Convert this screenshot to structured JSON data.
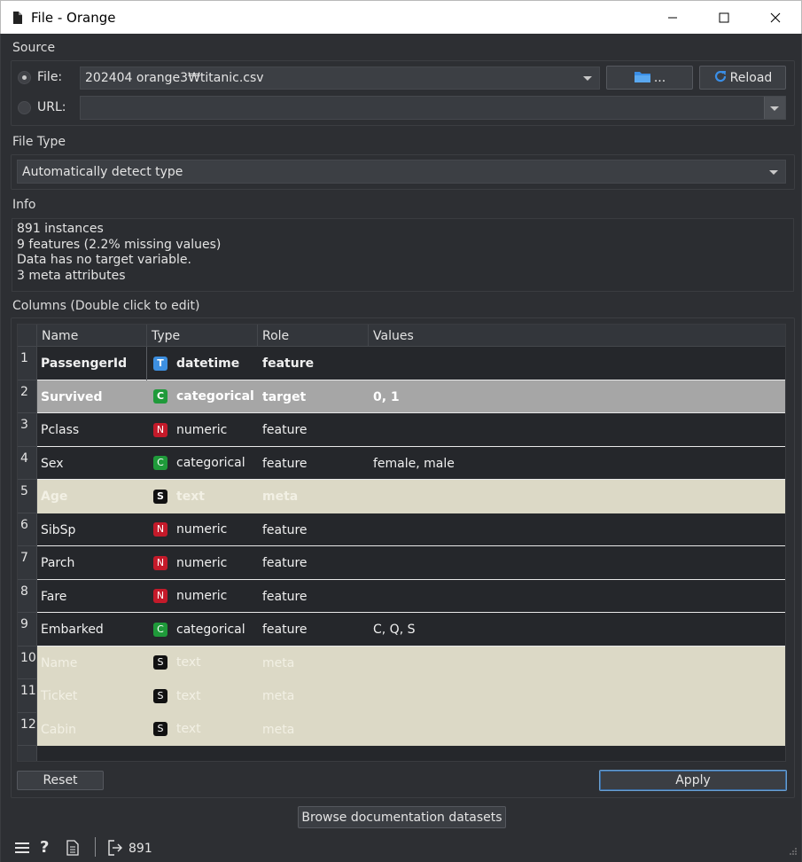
{
  "window": {
    "title": "File - Orange"
  },
  "source": {
    "label": "Source",
    "file_label": "File:",
    "file_value": "202404 orange3₩titanic.csv",
    "browse_label": "...",
    "reload_label": "Reload",
    "url_label": "URL:",
    "url_value": ""
  },
  "file_type": {
    "label": "File Type",
    "value": "Automatically detect type"
  },
  "info": {
    "label": "Info",
    "lines": [
      "891 instances",
      "9 features (2.2% missing values)",
      "Data has no target variable.",
      "3 meta attributes"
    ]
  },
  "columns": {
    "label": "Columns (Double click to edit)",
    "headers": [
      "Name",
      "Type",
      "Role",
      "Values"
    ],
    "rows": [
      {
        "num": "1",
        "name": "PassengerId",
        "type_letter": "T",
        "type": "datetime",
        "role": "feature",
        "values": "",
        "style": "normal-bold",
        "badge_color": "#3d8fe0"
      },
      {
        "num": "2",
        "name": "Survived",
        "type_letter": "C",
        "type": "categorical",
        "role": "target",
        "values": "0, 1",
        "style": "target",
        "badge_color": "#1f9a3a"
      },
      {
        "num": "3",
        "name": "Pclass",
        "type_letter": "N",
        "type": "numeric",
        "role": "feature",
        "values": "",
        "style": "normal",
        "badge_color": "#c41a2a"
      },
      {
        "num": "4",
        "name": "Sex",
        "type_letter": "C",
        "type": "categorical",
        "role": "feature",
        "values": "female, male",
        "style": "normal",
        "badge_color": "#1f9a3a"
      },
      {
        "num": "5",
        "name": "Age",
        "type_letter": "S",
        "type": "text",
        "role": "meta",
        "values": "",
        "style": "meta-bold",
        "badge_color": "#111111"
      },
      {
        "num": "6",
        "name": "SibSp",
        "type_letter": "N",
        "type": "numeric",
        "role": "feature",
        "values": "",
        "style": "normal",
        "badge_color": "#c41a2a"
      },
      {
        "num": "7",
        "name": "Parch",
        "type_letter": "N",
        "type": "numeric",
        "role": "feature",
        "values": "",
        "style": "normal",
        "badge_color": "#c41a2a"
      },
      {
        "num": "8",
        "name": "Fare",
        "type_letter": "N",
        "type": "numeric",
        "role": "feature",
        "values": "",
        "style": "normal",
        "badge_color": "#c41a2a"
      },
      {
        "num": "9",
        "name": "Embarked",
        "type_letter": "C",
        "type": "categorical",
        "role": "feature",
        "values": "C, Q, S",
        "style": "normal",
        "badge_color": "#1f9a3a"
      },
      {
        "num": "10",
        "name": "Name",
        "type_letter": "S",
        "type": "text",
        "role": "meta",
        "values": "",
        "style": "meta",
        "badge_color": "#111111"
      },
      {
        "num": "11",
        "name": "Ticket",
        "type_letter": "S",
        "type": "text",
        "role": "meta",
        "values": "",
        "style": "meta",
        "badge_color": "#111111"
      },
      {
        "num": "12",
        "name": "Cabin",
        "type_letter": "S",
        "type": "text",
        "role": "meta",
        "values": "",
        "style": "meta",
        "badge_color": "#111111"
      }
    ]
  },
  "buttons": {
    "reset": "Reset",
    "apply": "Apply",
    "browse_docs": "Browse documentation datasets"
  },
  "status": {
    "output_count": "891"
  }
}
